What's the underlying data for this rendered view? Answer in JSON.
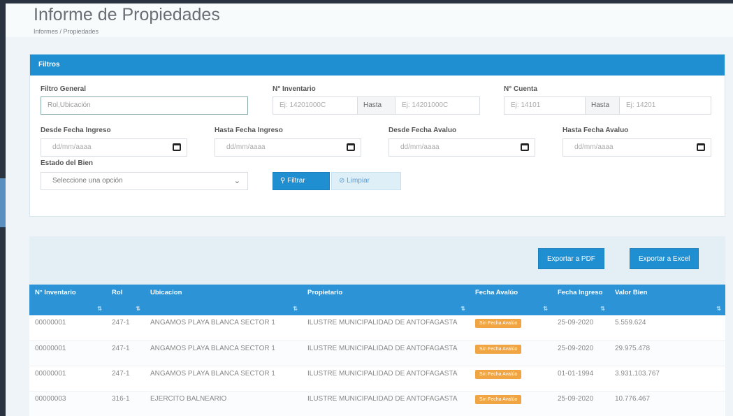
{
  "page": {
    "title": "Informe de Propiedades",
    "breadcrumb": "Informes / Propiedades"
  },
  "filters": {
    "header": "Filtros",
    "general_label": "Filtro General",
    "general_placeholder": "Rol,Ubicación",
    "inventario_label": "N° Inventario",
    "inventario_from_placeholder": "Ej: 14201000C",
    "inventario_to_placeholder": "Ej: 14201000C",
    "cuenta_label": "N° Cuenta",
    "cuenta_from_placeholder": "Ej: 14101",
    "cuenta_to_placeholder": "Ej: 14201",
    "hasta": "Hasta",
    "desde_ingreso_label": "Desde Fecha Ingreso",
    "hasta_ingreso_label": "Hasta Fecha Ingreso",
    "desde_avaluo_label": "Desde Fecha Avaluo",
    "hasta_avaluo_label": "Hasta Fecha Avaluo",
    "date_placeholder": "dd/mm/aaaa",
    "estado_label": "Estado del Bien",
    "estado_placeholder": "Seleccione una opción",
    "filtrar_button": "Filtrar",
    "limpiar_button": "Limpiar"
  },
  "export": {
    "pdf": "Exportar a PDF",
    "excel": "Exportar a Excel"
  },
  "table": {
    "headers": {
      "inventario": "N° Inventario",
      "rol": "Rol",
      "ubicacion": "Ubicacion",
      "propietario": "Propietario",
      "fecha_avaluo": "Fecha Avalúo",
      "fecha_ingreso": "Fecha Ingreso",
      "valor": "Valor Bien"
    },
    "rows": [
      {
        "inventario": "00000001",
        "rol": "247-1",
        "ubicacion": "ANGAMOS PLAYA BLANCA SECTOR 1",
        "propietario": "ILUSTRE MUNICIPALIDAD DE ANTOFAGASTA",
        "avaluo": "Sin Fecha Avalúo",
        "ingreso": "25-09-2020",
        "valor": "5.559.624"
      },
      {
        "inventario": "00000001",
        "rol": "247-1",
        "ubicacion": "ANGAMOS PLAYA BLANCA SECTOR 1",
        "propietario": "ILUSTRE MUNICIPALIDAD DE ANTOFAGASTA",
        "avaluo": "Sin Fecha Avalúo",
        "ingreso": "25-09-2020",
        "valor": "29.975.478"
      },
      {
        "inventario": "00000001",
        "rol": "247-1",
        "ubicacion": "ANGAMOS PLAYA BLANCA SECTOR 1",
        "propietario": "ILUSTRE MUNICIPALIDAD DE ANTOFAGASTA",
        "avaluo": "Sin Fecha Avalúo",
        "ingreso": "01-01-1994",
        "valor": "3.931.103.767"
      },
      {
        "inventario": "00000003",
        "rol": "316-1",
        "ubicacion": "EJERCITO BALNEARIO",
        "propietario": "ILUSTRE MUNICIPALIDAD DE ANTOFAGASTA",
        "avaluo": "Sin Fecha Avalúo",
        "ingreso": "25-09-2020",
        "valor": "10.776.467"
      }
    ]
  },
  "colors": {
    "primary": "#1f8fd1",
    "badge": "#f0a442",
    "sidebar": "#2a3440"
  },
  "icons": {
    "search": "search-icon",
    "clear": "eraser-icon",
    "calendar": "calendar-icon",
    "dropdown": "chevron-down-icon",
    "sort": "sort-icon"
  }
}
